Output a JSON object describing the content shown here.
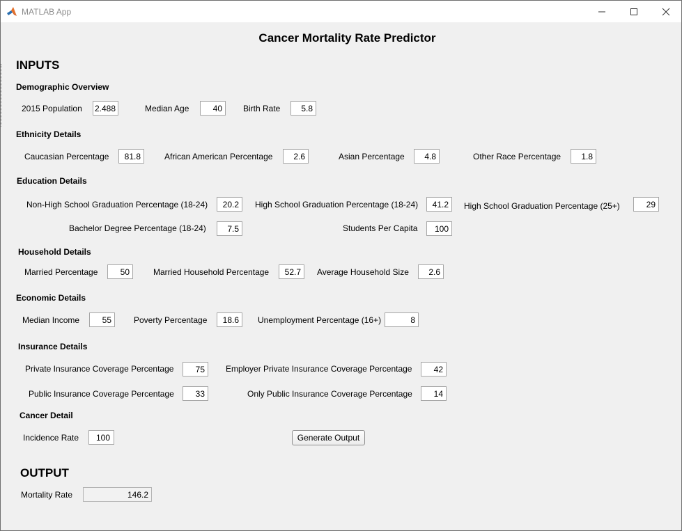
{
  "window": {
    "title": "MATLAB App",
    "icon": "matlab-icon",
    "controls": [
      "minimize-icon",
      "maximize-icon",
      "close-icon"
    ]
  },
  "app": {
    "title": "Cancer Mortality Rate Predictor"
  },
  "inputs": {
    "heading": "INPUTS",
    "demographic": {
      "heading": "Demographic Overview",
      "population_label": "2015 Population",
      "population_value": "2.488",
      "median_age_label": "Median Age",
      "median_age_value": "40",
      "birth_rate_label": "Birth Rate",
      "birth_rate_value": "5.8"
    },
    "ethnicity": {
      "heading": "Ethnicity Details",
      "caucasian_label": "Caucasian Percentage",
      "caucasian_value": "81.8",
      "african_american_label": "African American Percentage",
      "african_american_value": "2.6",
      "asian_label": "Asian Percentage",
      "asian_value": "4.8",
      "other_race_label": "Other Race Percentage",
      "other_race_value": "1.8"
    },
    "education": {
      "heading": "Education Details",
      "non_hs_grad_label": "Non-High School Graduation Percentage (18-24)",
      "non_hs_grad_value": "20.2",
      "hs_grad_18_label": "High School Graduation Percentage (18-24)",
      "hs_grad_18_value": "41.2",
      "hs_grad_25_label": "High School Graduation Percentage (25+)",
      "hs_grad_25_value": "29",
      "bachelor_label": "Bachelor Degree Percentage (18-24)",
      "bachelor_value": "7.5",
      "students_label": "Students Per Capita",
      "students_value": "100"
    },
    "household": {
      "heading": "Household Details",
      "married_label": "Married Percentage",
      "married_value": "50",
      "married_household_label": "Married Household Percentage",
      "married_household_value": "52.7",
      "household_size_label": "Average Household Size",
      "household_size_value": "2.6"
    },
    "economic": {
      "heading": "Economic Details",
      "median_income_label": "Median Income",
      "median_income_value": "55",
      "poverty_label": "Poverty Percentage",
      "poverty_value": "18.6",
      "unemployment_label": "Unemployment Percentage (16+)",
      "unemployment_value": "8"
    },
    "insurance": {
      "heading": "Insurance Details",
      "private_label": "Private Insurance Coverage Percentage",
      "private_value": "75",
      "employer_private_label": "Employer Private Insurance Coverage Percentage",
      "employer_private_value": "42",
      "public_label": "Public Insurance Coverage Percentage",
      "public_value": "33",
      "only_public_label": "Only Public Insurance Coverage Percentage",
      "only_public_value": "14"
    },
    "cancer": {
      "heading": "Cancer Detail",
      "incidence_label": "Incidence Rate",
      "incidence_value": "100"
    },
    "generate_button": "Generate Output"
  },
  "output": {
    "heading": "OUTPUT",
    "mortality_label": "Mortality Rate",
    "mortality_value": "146.2"
  }
}
